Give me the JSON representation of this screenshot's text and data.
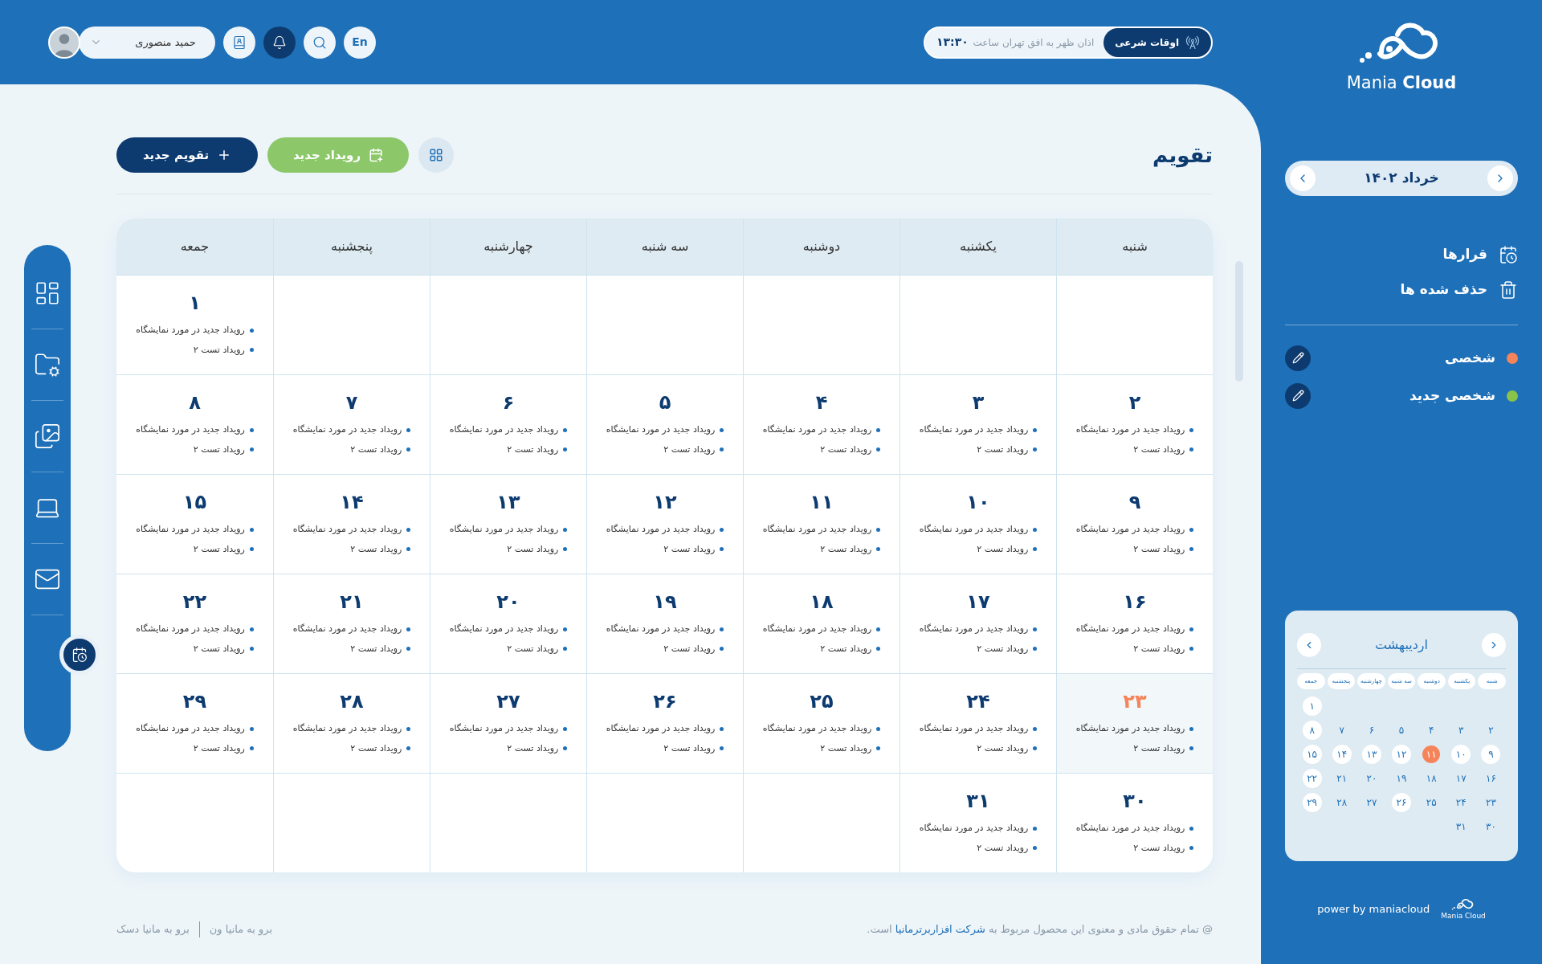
{
  "logo": {
    "text": "Mania **Cloud**"
  },
  "month_switcher": {
    "title": "خرداد ۱۴۰۲"
  },
  "menu": [
    {
      "kind": "appointments",
      "label": "قرارها"
    },
    {
      "kind": "trash",
      "label": "حذف شده ها"
    }
  ],
  "calendars": [
    {
      "label": "شخصی",
      "color": "#f5845a"
    },
    {
      "label": "شخصی جدید",
      "color": "#8bc34a"
    }
  ],
  "mini_calendar": {
    "title": "اردیبهشت",
    "weekdays": [
      "شنبه",
      "یکشنبه",
      "دوشنبه",
      "سه شنبه",
      "چهارشنبه",
      "پنجشنبه",
      "جمعه"
    ],
    "days": [
      {
        "kind": "blank"
      },
      {
        "kind": "blank"
      },
      {
        "kind": "blank"
      },
      {
        "kind": "blank"
      },
      {
        "kind": "blank"
      },
      {
        "kind": "blank"
      },
      {
        "kind": "day",
        "day": "۱",
        "marked": true,
        "selected": false
      },
      {
        "kind": "day",
        "day": "۲",
        "marked": false,
        "selected": false
      },
      {
        "kind": "day",
        "day": "۳",
        "marked": false,
        "selected": false
      },
      {
        "kind": "day",
        "day": "۴",
        "marked": false,
        "selected": false
      },
      {
        "kind": "day",
        "day": "۵",
        "marked": false,
        "selected": false
      },
      {
        "kind": "day",
        "day": "۶",
        "marked": false,
        "selected": false
      },
      {
        "kind": "day",
        "day": "۷",
        "marked": false,
        "selected": false
      },
      {
        "kind": "day",
        "day": "۸",
        "marked": true,
        "selected": false
      },
      {
        "kind": "day",
        "day": "۹",
        "marked": true,
        "selected": false
      },
      {
        "kind": "day",
        "day": "۱۰",
        "marked": true,
        "selected": false
      },
      {
        "kind": "day",
        "day": "۱۱",
        "marked": false,
        "selected": true
      },
      {
        "kind": "day",
        "day": "۱۲",
        "marked": true,
        "selected": false
      },
      {
        "kind": "day",
        "day": "۱۳",
        "marked": true,
        "selected": false
      },
      {
        "kind": "day",
        "day": "۱۴",
        "marked": true,
        "selected": false
      },
      {
        "kind": "day",
        "day": "۱۵",
        "marked": true,
        "selected": false
      },
      {
        "kind": "day",
        "day": "۱۶",
        "marked": false,
        "selected": false
      },
      {
        "kind": "day",
        "day": "۱۷",
        "marked": false,
        "selected": false
      },
      {
        "kind": "day",
        "day": "۱۸",
        "marked": false,
        "selected": false
      },
      {
        "kind": "day",
        "day": "۱۹",
        "marked": false,
        "selected": false
      },
      {
        "kind": "day",
        "day": "۲۰",
        "marked": false,
        "selected": false
      },
      {
        "kind": "day",
        "day": "۲۱",
        "marked": false,
        "selected": false
      },
      {
        "kind": "day",
        "day": "۲۲",
        "marked": true,
        "selected": false
      },
      {
        "kind": "day",
        "day": "۲۳",
        "marked": false,
        "selected": false
      },
      {
        "kind": "day",
        "day": "۲۴",
        "marked": false,
        "selected": false
      },
      {
        "kind": "day",
        "day": "۲۵",
        "marked": false,
        "selected": false
      },
      {
        "kind": "day",
        "day": "۲۶",
        "marked": true,
        "selected": false
      },
      {
        "kind": "day",
        "day": "۲۷",
        "marked": false,
        "selected": false
      },
      {
        "kind": "day",
        "day": "۲۸",
        "marked": false,
        "selected": false
      },
      {
        "kind": "day",
        "day": "۲۹",
        "marked": true,
        "selected": false
      },
      {
        "kind": "day",
        "day": "۳۰",
        "marked": false,
        "selected": false
      },
      {
        "kind": "day",
        "day": "۳۱",
        "marked": false,
        "selected": false
      }
    ]
  },
  "sidebar_footer": {
    "text": "power by maniacloud",
    "logo_text": "Mania Cloud"
  },
  "header": {
    "prayer_times": {
      "label": "اوقات شرعی",
      "text": "اذان ظهر به افق تهران ساعت",
      "time": "۱۳:۳۰"
    },
    "language_button": "En",
    "icon_buttons": [
      {
        "kind": "search",
        "selected": false
      },
      {
        "kind": "notifications",
        "selected": true
      },
      {
        "kind": "contacts",
        "selected": false
      }
    ],
    "user": {
      "name": "حمید منصوری"
    }
  },
  "page": {
    "title": "تقویم",
    "buttons": [
      {
        "kind": "new_event",
        "label": "رویداد جدید"
      },
      {
        "kind": "new_calendar",
        "label": "تقویم جدید"
      }
    ]
  },
  "left_nav": [
    {
      "kind": "dashboard",
      "selected": false
    },
    {
      "kind": "files",
      "selected": false
    },
    {
      "kind": "gallery",
      "selected": false
    },
    {
      "kind": "support",
      "selected": false
    },
    {
      "kind": "mail",
      "selected": false
    },
    {
      "kind": "calendar",
      "selected": true
    }
  ],
  "calendar": {
    "weekdays": [
      "شنبه",
      "یکشنبه",
      "دوشنبه",
      "سه شنبه",
      "چهارشنبه",
      "پنجشنبه",
      "جمعه"
    ],
    "cells": [
      {
        "kind": "blank"
      },
      {
        "kind": "blank"
      },
      {
        "kind": "blank"
      },
      {
        "kind": "blank"
      },
      {
        "kind": "blank"
      },
      {
        "kind": "blank"
      },
      {
        "kind": "day",
        "day": "۱",
        "selected": false,
        "events": [
          "رویداد جدید در مورد نمایشگاه",
          "رویداد تست ۲"
        ]
      },
      {
        "kind": "day",
        "day": "۲",
        "selected": false,
        "events": [
          "رویداد جدید در مورد نمایشگاه",
          "رویداد تست ۲"
        ]
      },
      {
        "kind": "day",
        "day": "۳",
        "selected": false,
        "events": [
          "رویداد جدید در مورد نمایشگاه",
          "رویداد تست ۲"
        ]
      },
      {
        "kind": "day",
        "day": "۴",
        "selected": false,
        "events": [
          "رویداد جدید در مورد نمایشگاه",
          "رویداد تست ۲"
        ]
      },
      {
        "kind": "day",
        "day": "۵",
        "selected": false,
        "events": [
          "رویداد جدید در مورد نمایشگاه",
          "رویداد تست ۲"
        ]
      },
      {
        "kind": "day",
        "day": "۶",
        "selected": false,
        "events": [
          "رویداد جدید در مورد نمایشگاه",
          "رویداد تست ۲"
        ]
      },
      {
        "kind": "day",
        "day": "۷",
        "selected": false,
        "events": [
          "رویداد جدید در مورد نمایشگاه",
          "رویداد تست ۲"
        ]
      },
      {
        "kind": "day",
        "day": "۸",
        "selected": false,
        "events": [
          "رویداد جدید در مورد نمایشگاه",
          "رویداد تست ۲"
        ]
      },
      {
        "kind": "day",
        "day": "۹",
        "selected": false,
        "events": [
          "رویداد جدید در مورد نمایشگاه",
          "رویداد تست ۲"
        ]
      },
      {
        "kind": "day",
        "day": "۱۰",
        "selected": false,
        "events": [
          "رویداد جدید در مورد نمایشگاه",
          "رویداد تست ۲"
        ]
      },
      {
        "kind": "day",
        "day": "۱۱",
        "selected": false,
        "events": [
          "رویداد جدید در مورد نمایشگاه",
          "رویداد تست ۲"
        ]
      },
      {
        "kind": "day",
        "day": "۱۲",
        "selected": false,
        "events": [
          "رویداد جدید در مورد نمایشگاه",
          "رویداد تست ۲"
        ]
      },
      {
        "kind": "day",
        "day": "۱۳",
        "selected": false,
        "events": [
          "رویداد جدید در مورد نمایشگاه",
          "رویداد تست ۲"
        ]
      },
      {
        "kind": "day",
        "day": "۱۴",
        "selected": false,
        "events": [
          "رویداد جدید در مورد نمایشگاه",
          "رویداد تست ۲"
        ]
      },
      {
        "kind": "day",
        "day": "۱۵",
        "selected": false,
        "events": [
          "رویداد جدید در مورد نمایشگاه",
          "رویداد تست ۲"
        ]
      },
      {
        "kind": "day",
        "day": "۱۶",
        "selected": false,
        "events": [
          "رویداد جدید در مورد نمایشگاه",
          "رویداد تست ۲"
        ]
      },
      {
        "kind": "day",
        "day": "۱۷",
        "selected": false,
        "events": [
          "رویداد جدید در مورد نمایشگاه",
          "رویداد تست ۲"
        ]
      },
      {
        "kind": "day",
        "day": "۱۸",
        "selected": false,
        "events": [
          "رویداد جدید در مورد نمایشگاه",
          "رویداد تست ۲"
        ]
      },
      {
        "kind": "day",
        "day": "۱۹",
        "selected": false,
        "events": [
          "رویداد جدید در مورد نمایشگاه",
          "رویداد تست ۲"
        ]
      },
      {
        "kind": "day",
        "day": "۲۰",
        "selected": false,
        "events": [
          "رویداد جدید در مورد نمایشگاه",
          "رویداد تست ۲"
        ]
      },
      {
        "kind": "day",
        "day": "۲۱",
        "selected": false,
        "events": [
          "رویداد جدید در مورد نمایشگاه",
          "رویداد تست ۲"
        ]
      },
      {
        "kind": "day",
        "day": "۲۲",
        "selected": false,
        "events": [
          "رویداد جدید در مورد نمایشگاه",
          "رویداد تست ۲"
        ]
      },
      {
        "kind": "day",
        "day": "۲۳",
        "selected": true,
        "events": [
          "رویداد جدید در مورد نمایشگاه",
          "رویداد تست ۲"
        ]
      },
      {
        "kind": "day",
        "day": "۲۴",
        "selected": false,
        "events": [
          "رویداد جدید در مورد نمایشگاه",
          "رویداد تست ۲"
        ]
      },
      {
        "kind": "day",
        "day": "۲۵",
        "selected": false,
        "events": [
          "رویداد جدید در مورد نمایشگاه",
          "رویداد تست ۲"
        ]
      },
      {
        "kind": "day",
        "day": "۲۶",
        "selected": false,
        "events": [
          "رویداد جدید در مورد نمایشگاه",
          "رویداد تست ۲"
        ]
      },
      {
        "kind": "day",
        "day": "۲۷",
        "selected": false,
        "events": [
          "رویداد جدید در مورد نمایشگاه",
          "رویداد تست ۲"
        ]
      },
      {
        "kind": "day",
        "day": "۲۸",
        "selected": false,
        "events": [
          "رویداد جدید در مورد نمایشگاه",
          "رویداد تست ۲"
        ]
      },
      {
        "kind": "day",
        "day": "۲۹",
        "selected": false,
        "events": [
          "رویداد جدید در مورد نمایشگاه",
          "رویداد تست ۲"
        ]
      },
      {
        "kind": "day",
        "day": "۳۰",
        "selected": false,
        "events": [
          "رویداد جدید در مورد نمایشگاه",
          "رویداد تست ۲"
        ]
      },
      {
        "kind": "day",
        "day": "۳۱",
        "selected": false,
        "events": [
          "رویداد جدید در مورد نمایشگاه",
          "رویداد تست ۲"
        ]
      },
      {
        "kind": "blank"
      },
      {
        "kind": "blank"
      },
      {
        "kind": "blank"
      },
      {
        "kind": "blank"
      },
      {
        "kind": "blank"
      }
    ]
  },
  "footer": {
    "copyright_prefix": "@ تمام حقوق مادی و معنوی این محصول مربوط به",
    "company_link": "شرکت افزاربرترمانیا",
    "copyright_suffix": "است.",
    "links": [
      "برو به مانیا ون",
      "برو به مانیا دسک"
    ]
  }
}
